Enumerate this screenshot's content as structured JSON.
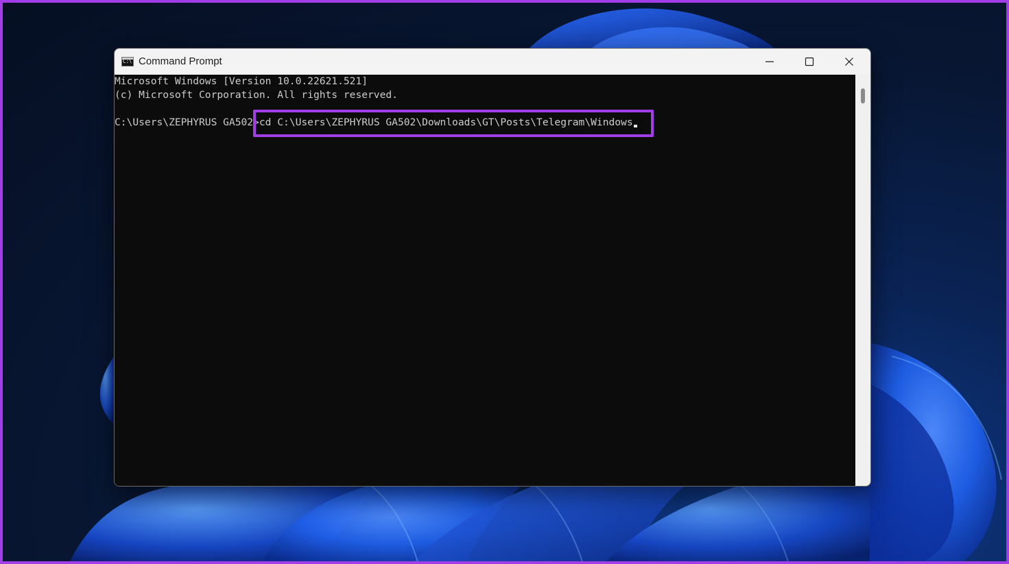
{
  "window": {
    "title": "Command Prompt",
    "icon": "cmd-app-icon",
    "icon_glyph": "C:\\",
    "controls": {
      "minimize": "minimize-icon",
      "maximize": "maximize-icon",
      "close": "close-icon"
    }
  },
  "console": {
    "lines": [
      "Microsoft Windows [Version 10.0.22621.521]",
      "(c) Microsoft Corporation. All rights reserved."
    ],
    "prompt": "C:\\Users\\ZEPHYRUS GA502",
    "prompt_symbol": ">",
    "command": "cd C:\\Users\\ZEPHYRUS GA502\\Downloads\\GT\\Posts\\Telegram\\Windows"
  },
  "colors": {
    "highlight": "#a23ee8",
    "console_bg": "#0c0c0c",
    "console_text": "#cccccc",
    "titlebar_bg": "#f3f3f3"
  }
}
